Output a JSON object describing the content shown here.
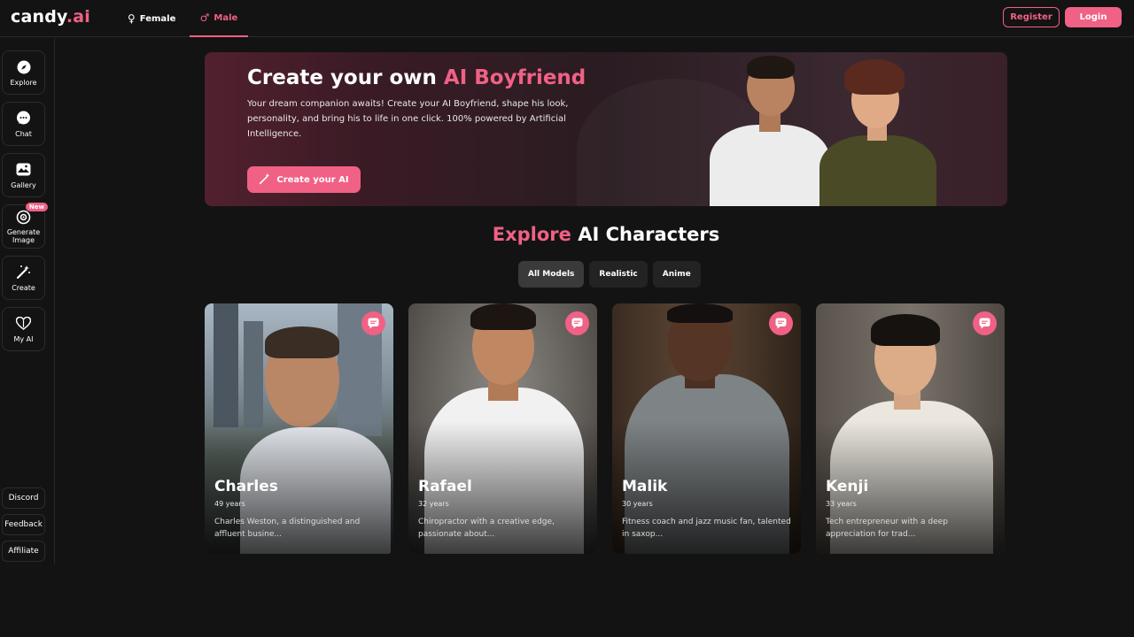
{
  "brand": {
    "name": "candy",
    "suffix": ".ai"
  },
  "gender_tabs": [
    {
      "label": "Female",
      "icon": "female-icon"
    },
    {
      "label": "Male",
      "icon": "male-icon",
      "active": true
    }
  ],
  "auth": {
    "register_label": "Register",
    "login_label": "Login"
  },
  "sidebar": {
    "items": [
      {
        "label": "Explore",
        "icon": "compass-icon"
      },
      {
        "label": "Chat",
        "icon": "chat-icon"
      },
      {
        "label": "Gallery",
        "icon": "gallery-icon"
      },
      {
        "label": "Generate Image",
        "icon": "generate-image-icon",
        "badge": "New"
      },
      {
        "label": "Create",
        "icon": "magic-wand-icon"
      },
      {
        "label": "My AI",
        "icon": "heart-icon"
      }
    ],
    "links": [
      {
        "label": "Discord"
      },
      {
        "label": "Feedback"
      },
      {
        "label": "Affiliate"
      }
    ]
  },
  "hero": {
    "title_prefix": "Create your own ",
    "title_accent": "AI Boyfriend",
    "description": "Your dream companion awaits! Create your AI Boyfriend, shape his look, personality, and bring his to life in one click. 100% powered by Artificial Intelligence.",
    "button_label": "Create your AI"
  },
  "explore": {
    "title_accent": "Explore",
    "title_rest": " AI Characters",
    "filters": [
      {
        "label": "All Models",
        "active": true
      },
      {
        "label": "Realistic"
      },
      {
        "label": "Anime"
      }
    ]
  },
  "characters": [
    {
      "name": "Charles",
      "age": "49 years",
      "description": "Charles Weston, a distinguished and affluent busine..."
    },
    {
      "name": "Rafael",
      "age": "32 years",
      "description": "Chiropractor with a creative edge, passionate about..."
    },
    {
      "name": "Malik",
      "age": "30 years",
      "description": "Fitness coach and jazz music fan, talented in saxop..."
    },
    {
      "name": "Kenji",
      "age": "33 years",
      "description": "Tech entrepreneur with a deep appreciation for trad..."
    }
  ],
  "colors": {
    "accent": "#f06185",
    "background": "#131313"
  }
}
